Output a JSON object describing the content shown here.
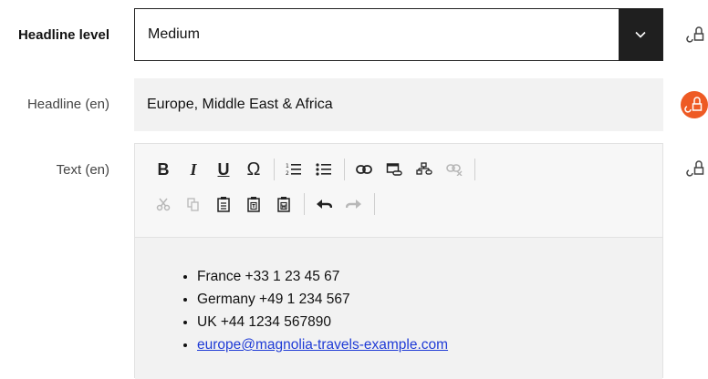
{
  "headline_level": {
    "label": "Headline level",
    "value": "Medium"
  },
  "headline": {
    "label": "Headline (en)",
    "value": "Europe, Middle East & Africa"
  },
  "text": {
    "label": "Text (en)",
    "items": [
      "France +33 1 23 45 67",
      "Germany +49 1 234 567",
      "UK +44 1234 567890"
    ],
    "link": "europe@magnolia-travels-example.com"
  },
  "toolbar_glyphs": {
    "bold": "B",
    "italic": "I",
    "underline": "U",
    "special_char": "Ω"
  },
  "colors": {
    "accent": "#ee5a24",
    "select_arrow_bg": "#1f1f1f",
    "field_bg": "#f2f2f2",
    "link": "#1f3bd6"
  }
}
